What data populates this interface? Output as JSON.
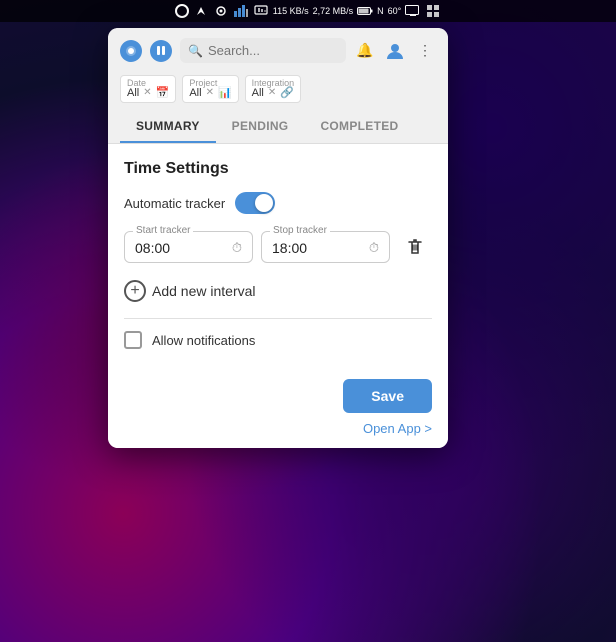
{
  "systemBar": {
    "networkSpeed": "115 KB/s",
    "networkSpeed2": "2,72 MB/s",
    "temperature": "60°",
    "icons": [
      "circle",
      "nav",
      "signal",
      "bars",
      "monitor",
      "battery",
      "network",
      "temp",
      "display",
      "grid"
    ]
  },
  "popup": {
    "search": {
      "placeholder": "Search...",
      "value": ""
    },
    "filters": {
      "date": {
        "label": "Date",
        "value": "All"
      },
      "project": {
        "label": "Project",
        "value": "All"
      },
      "integration": {
        "label": "Integration",
        "value": "All"
      }
    },
    "tabs": [
      {
        "id": "summary",
        "label": "SUMMARY",
        "active": true
      },
      {
        "id": "pending",
        "label": "PENDING",
        "active": false
      },
      {
        "id": "completed",
        "label": "COMPLETED",
        "active": false
      }
    ],
    "content": {
      "title": "Time Settings",
      "automaticTracker": {
        "label": "Automatic tracker",
        "enabled": true
      },
      "intervals": [
        {
          "startLabel": "Start tracker",
          "startValue": "08:00",
          "stopLabel": "Stop tracker",
          "stopValue": "18:00"
        }
      ],
      "addNewInterval": "Add new interval",
      "allowNotifications": "Allow notifications",
      "notificationsChecked": false
    },
    "footer": {
      "saveLabel": "Save",
      "openAppLabel": "Open App >"
    }
  }
}
